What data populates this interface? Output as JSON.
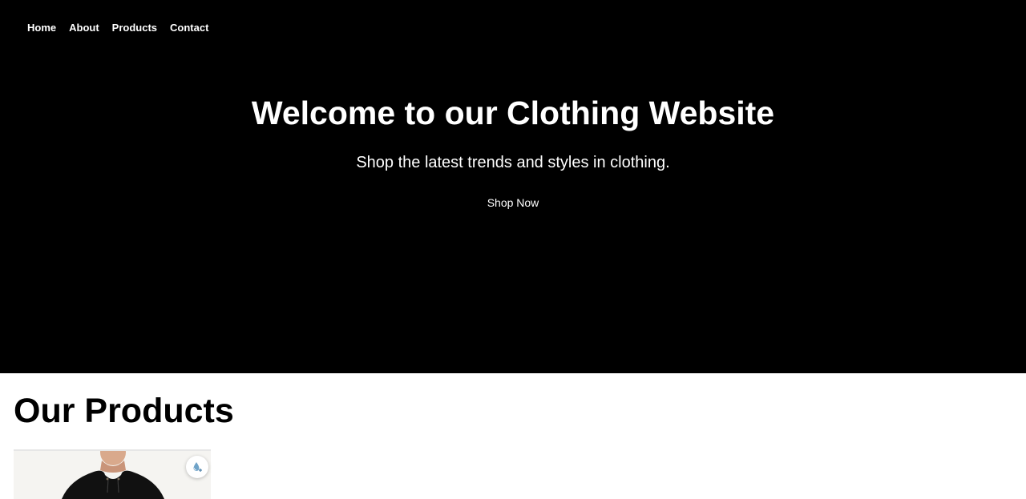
{
  "nav": {
    "items": [
      {
        "label": "Home"
      },
      {
        "label": "About"
      },
      {
        "label": "Products"
      },
      {
        "label": "Contact"
      }
    ]
  },
  "hero": {
    "title": "Welcome to our Clothing Website",
    "subtitle": "Shop the latest trends and styles in clothing.",
    "cta_label": "Shop Now",
    "background_color": "#000000",
    "text_color": "#ffffff"
  },
  "products": {
    "title": "Our Products",
    "items": [
      {
        "image_icon": "hoodie-model-image"
      }
    ]
  },
  "floating_action": {
    "icon": "water-drop-plus-icon"
  }
}
